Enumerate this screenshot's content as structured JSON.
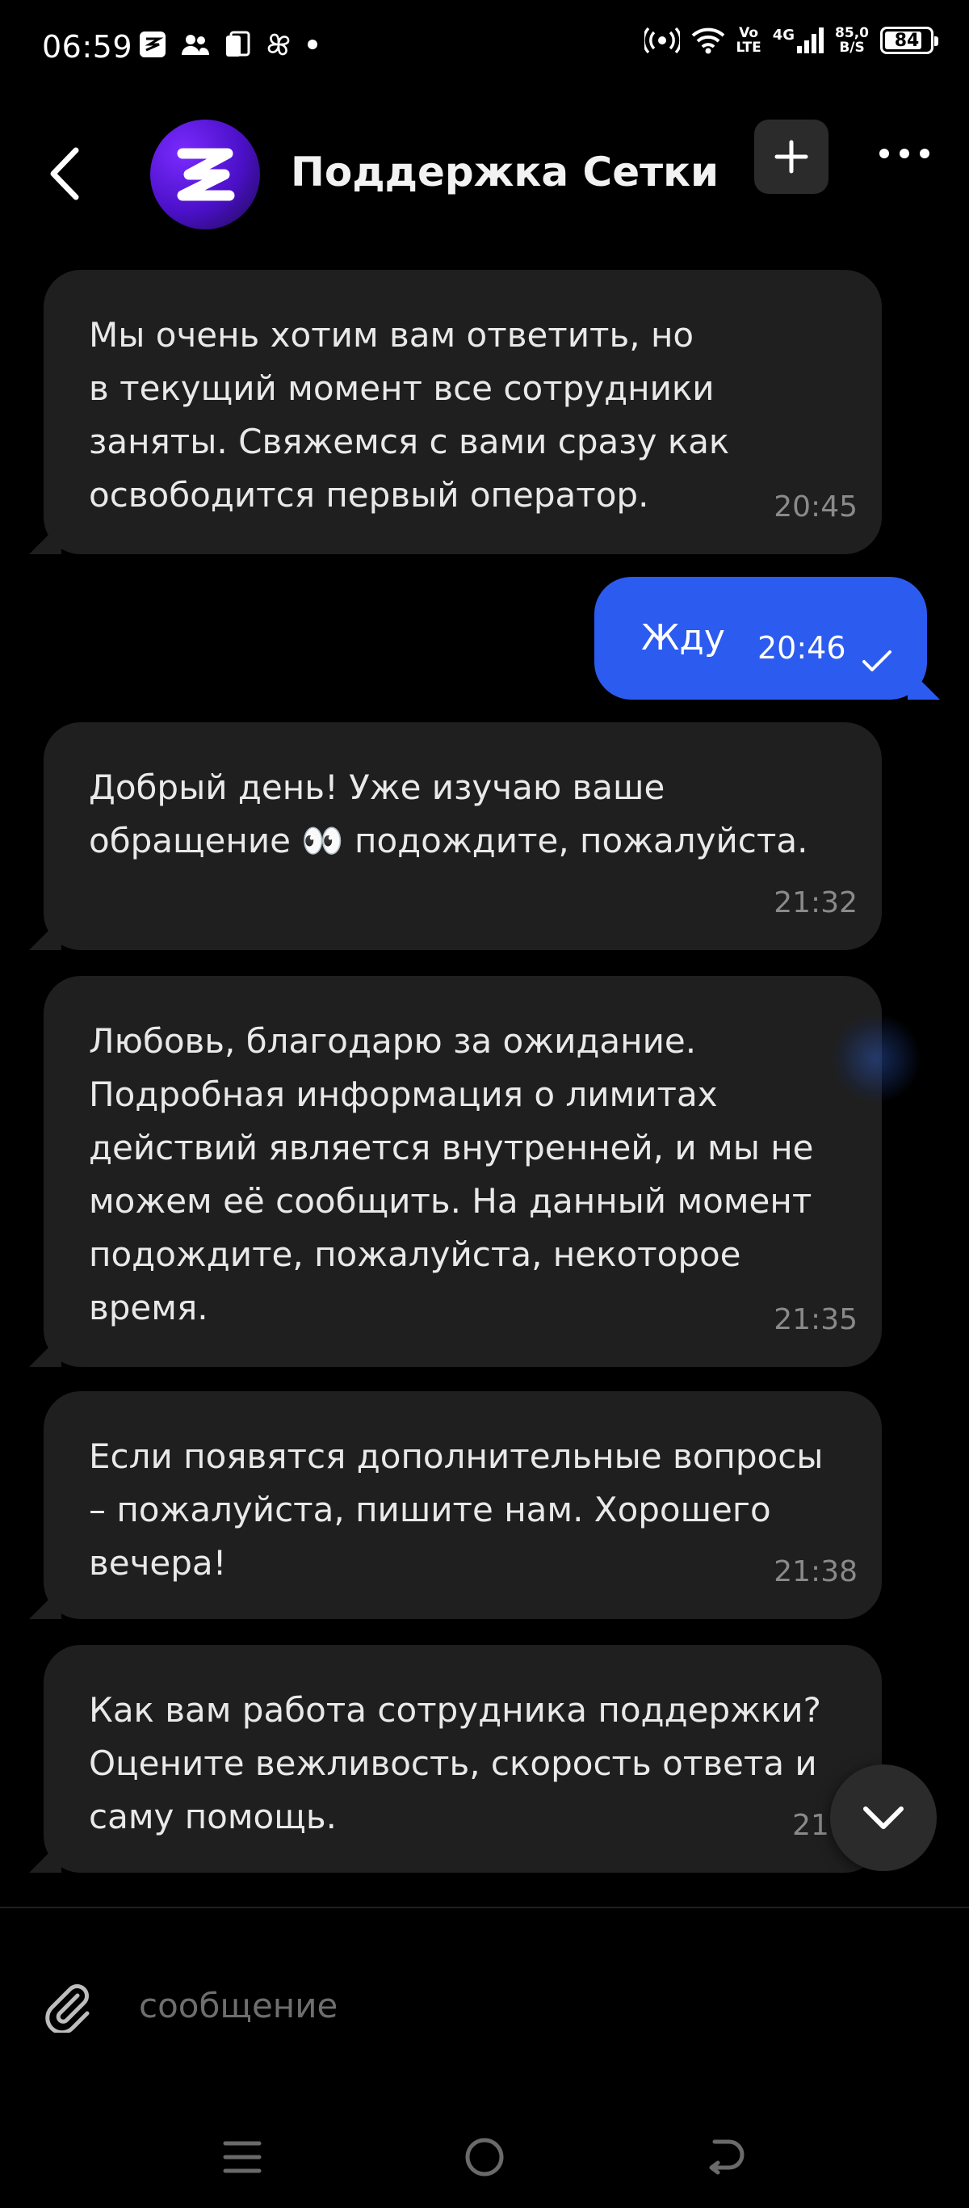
{
  "status_bar": {
    "time": "06:59",
    "volte_top": "Vo",
    "volte_bottom": "LTE",
    "network": "4G",
    "speed_top": "85,0",
    "speed_bottom": "B/S",
    "battery": "84",
    "battery_level": 0.84
  },
  "header": {
    "title": "Поддержка Сетки"
  },
  "messages": [
    {
      "direction": "incoming",
      "text": "Мы очень хотим вам ответить, но\nв текущий момент все сотрудники\nзаняты. Свяжемся с вами сразу как\nосвободится первый оператор.",
      "time": "20:45"
    },
    {
      "direction": "outgoing",
      "text": "Жду",
      "time": "20:46",
      "status": "sent"
    },
    {
      "direction": "incoming",
      "text": "Добрый день! Уже изучаю ваше\nобращение 👀 подождите, пожалуйста.",
      "time": "21:32"
    },
    {
      "direction": "incoming",
      "text": "Любовь, благодарю за ожидание.\nПодробная информация о лимитах\nдействий является внутренней, и мы не\nможем её сообщить. На данный момент\nподождите, пожалуйста, некоторое\nвремя.",
      "time": "21:35"
    },
    {
      "direction": "incoming",
      "text": "Если появятся дополнительные вопросы\n– пожалуйста, пишите нам. Хорошего\nвечера!",
      "time": "21:38"
    },
    {
      "direction": "incoming",
      "text": "Как вам работа сотрудника поддержки?\nОцените вежливость, скорость ответа и\nсаму помощь.",
      "time": "21:3"
    }
  ],
  "composer": {
    "placeholder": "сообщение"
  },
  "colors": {
    "background": "#000000",
    "incoming_bubble": "#1f1f1f",
    "outgoing_bubble": "#2c5bf0"
  }
}
